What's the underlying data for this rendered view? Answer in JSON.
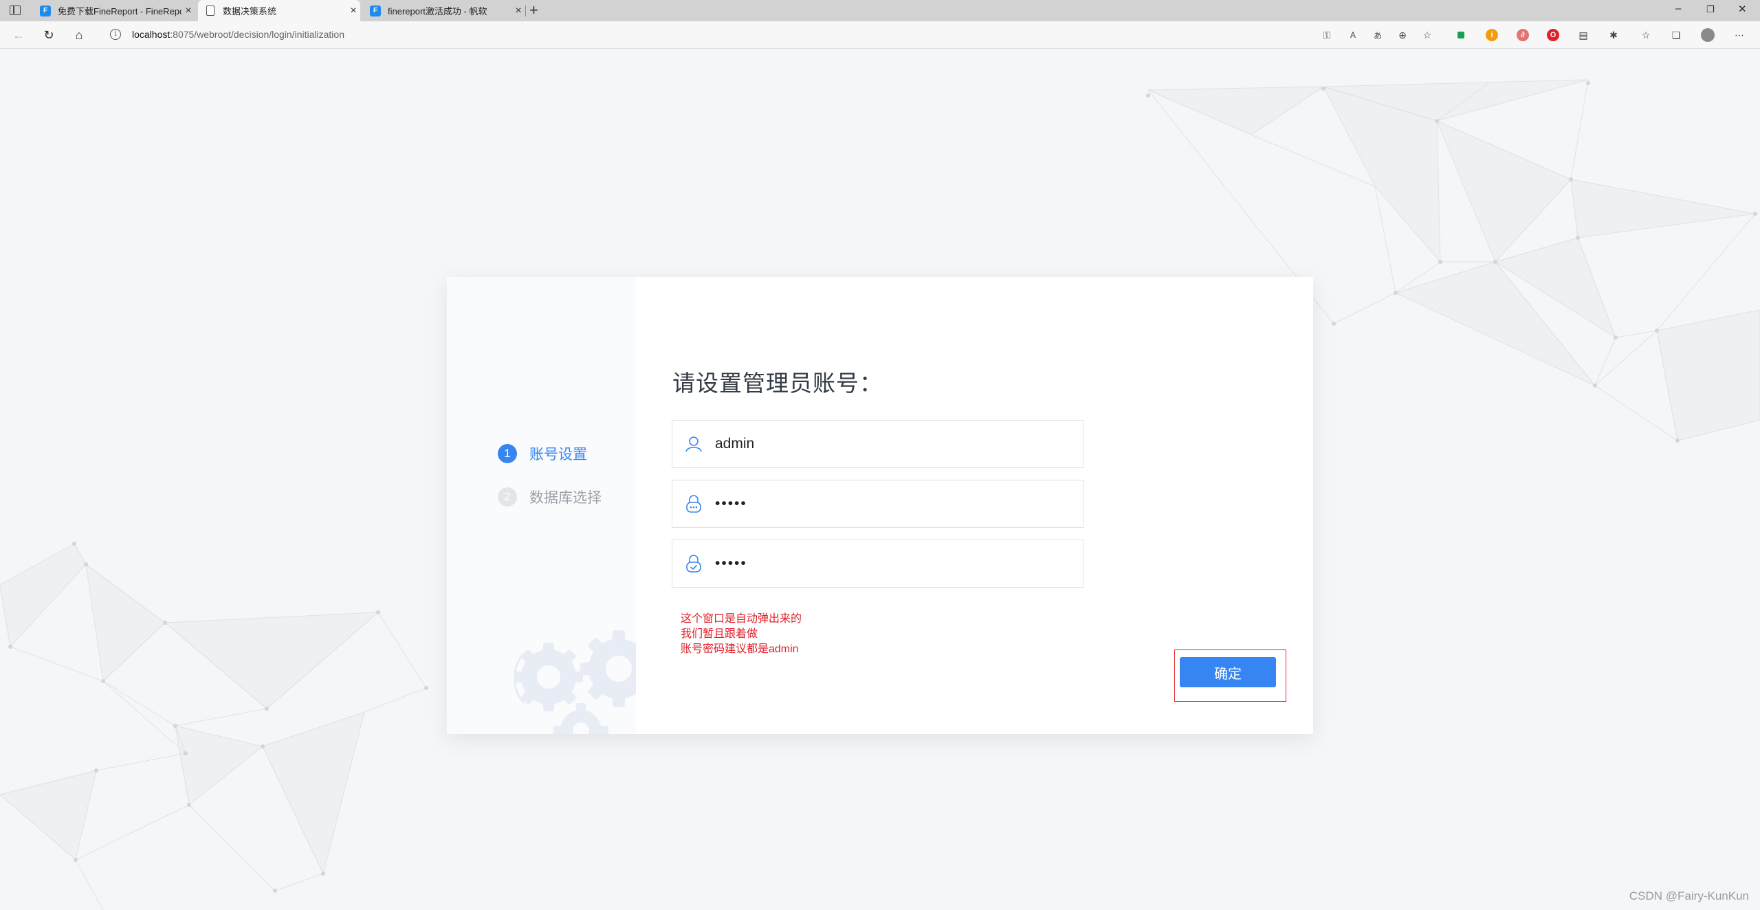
{
  "browser": {
    "tabs": [
      {
        "title": "免费下载FineReport - FineReport",
        "icon": "finereport-favicon",
        "active": false
      },
      {
        "title": "数据决策系统",
        "icon": "page-icon",
        "active": true
      },
      {
        "title": "finereport激活成功 - 帆软",
        "icon": "finereport-favicon",
        "active": false
      }
    ],
    "new_tab_label": "+",
    "address": {
      "host": "localhost",
      "path": ":8075/webroot/decision/login/initialization"
    },
    "window_controls": {
      "minimize": "–",
      "restore": "❐",
      "close": "✕"
    }
  },
  "wizard": {
    "steps": [
      {
        "number": "1",
        "label": "账号设置",
        "state": "active"
      },
      {
        "number": "2",
        "label": "数据库选择",
        "state": "inactive"
      }
    ],
    "title": "请设置管理员账号：",
    "username": {
      "value": "admin",
      "icon": "user-icon"
    },
    "password": {
      "value": "•••••",
      "icon": "lock-icon"
    },
    "confirm_password": {
      "value": "•••••",
      "icon": "lock-check-icon"
    },
    "confirm_label": "确定"
  },
  "annotation": {
    "lines": [
      "这个窗口是自动弹出来的",
      "我们暂且跟着做",
      "账号密码建议都是admin"
    ]
  },
  "watermark": "CSDN @Fairy-KunKun",
  "colors": {
    "accent": "#3685f2",
    "annotation_red": "#e0202a",
    "background": "#f5f6f8"
  }
}
